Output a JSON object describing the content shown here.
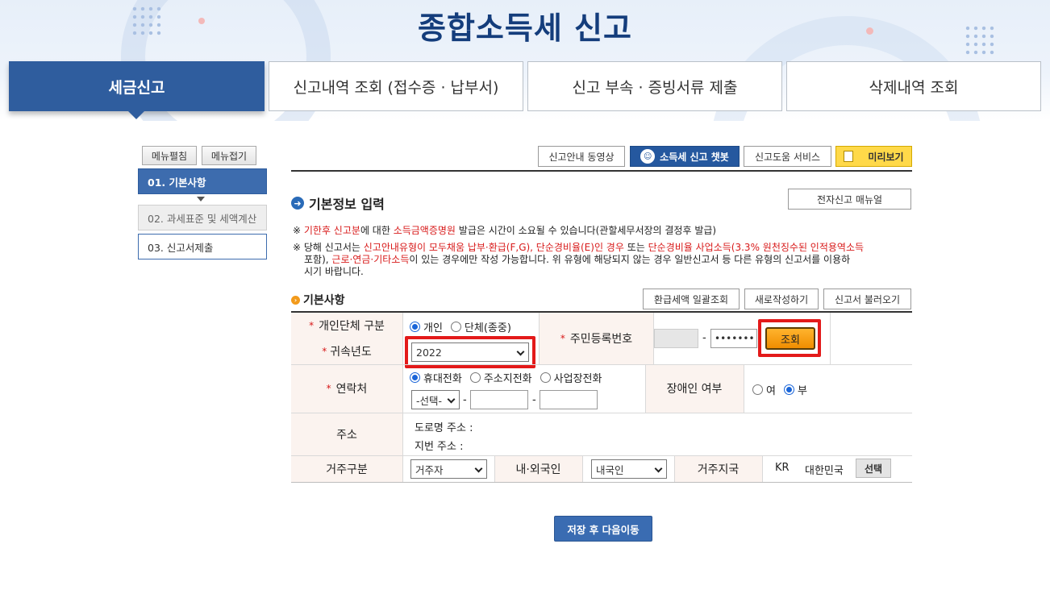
{
  "page_title": "종합소득세 신고",
  "tabs": [
    {
      "label": "세금신고",
      "active": true
    },
    {
      "label": "신고내역 조회 (접수증 · 납부서)",
      "active": false
    },
    {
      "label": "신고 부속 · 증빙서류 제출",
      "active": false
    },
    {
      "label": "삭제내역 조회",
      "active": false
    }
  ],
  "sidebar": {
    "expand_label": "메뉴펼침",
    "collapse_label": "메뉴접기",
    "steps": [
      {
        "label": "01. 기본사항",
        "state": "active"
      },
      {
        "label": "02. 과세표준 및 세액계산",
        "state": "disabled"
      },
      {
        "label": "03. 신고서제출",
        "state": "normal"
      }
    ]
  },
  "toolbar": {
    "video_label": "신고안내 동영상",
    "chatbot_label": "소득세 신고 챗봇",
    "help_label": "신고도움 서비스",
    "preview_label": "미리보기"
  },
  "section": {
    "title": "기본정보 입력",
    "manual_label": "전자신고 매뉴얼"
  },
  "notices": {
    "n1_prefix": "※ ",
    "n1_red1": "기한후 신고분",
    "n1_mid": "에 대한 ",
    "n1_red2": "소득금액증명원",
    "n1_suffix": " 발급은 시간이 소요될 수 있습니다(관할세무서장의 결정후 발급)",
    "n2_prefix": "※ 당해 신고서는 ",
    "n2_red1": "신고안내유형이 모두채움 납부·환급(F,G), 단순경비율(E)인 경우",
    "n2_mid1": " 또는 ",
    "n2_red2": "단순경비율 사업소득",
    "n2_red3": "(3.3% 원천징수된 인적용역소득",
    "n2_line2_a": "포함), ",
    "n2_red4": "근로·연금·기타소득",
    "n2_line2_b": "이 있는 경우에만 작성 가능합니다. 위 유형에 해당되지 않는 경우 일반신고서 등 다른 유형의 신고서를 이용하",
    "n2_line3": "시기 바랍니다."
  },
  "basic": {
    "title": "기본사항",
    "refund_btn": "환급세액 일괄조회",
    "new_btn": "새로작성하기",
    "load_btn": "신고서 불러오기",
    "req_mark": "*",
    "type_label": "개인단체 구분",
    "type_options": [
      "개인",
      "단체(종중)"
    ],
    "type_selected": "개인",
    "year_label": "귀속년도",
    "year_value": "2022",
    "rrn_label": "주민등록번호",
    "rrn_dash": "-",
    "rrn_back": "•••••••",
    "lookup_btn": "조회",
    "contact_label": "연락처",
    "contact_options": [
      "휴대전화",
      "주소지전화",
      "사업장전화"
    ],
    "contact_selected": "휴대전화",
    "phone_prefix": "-선택-",
    "phone_dash": "-",
    "disabled_label": "장애인 여부",
    "disabled_options": [
      "여",
      "부"
    ],
    "disabled_selected": "부",
    "address_label": "주소",
    "road_address": "도로명 주소 :",
    "lot_address": "지번 주소 :",
    "residence_label": "거주구분",
    "residence_value": "거주자",
    "nationality_label": "내·외국인",
    "nationality_value": "내국인",
    "country_label": "거주지국",
    "country_code": "KR",
    "country_name": "대한민국",
    "select_btn": "선택"
  },
  "save_next": "저장 후 다음이동"
}
